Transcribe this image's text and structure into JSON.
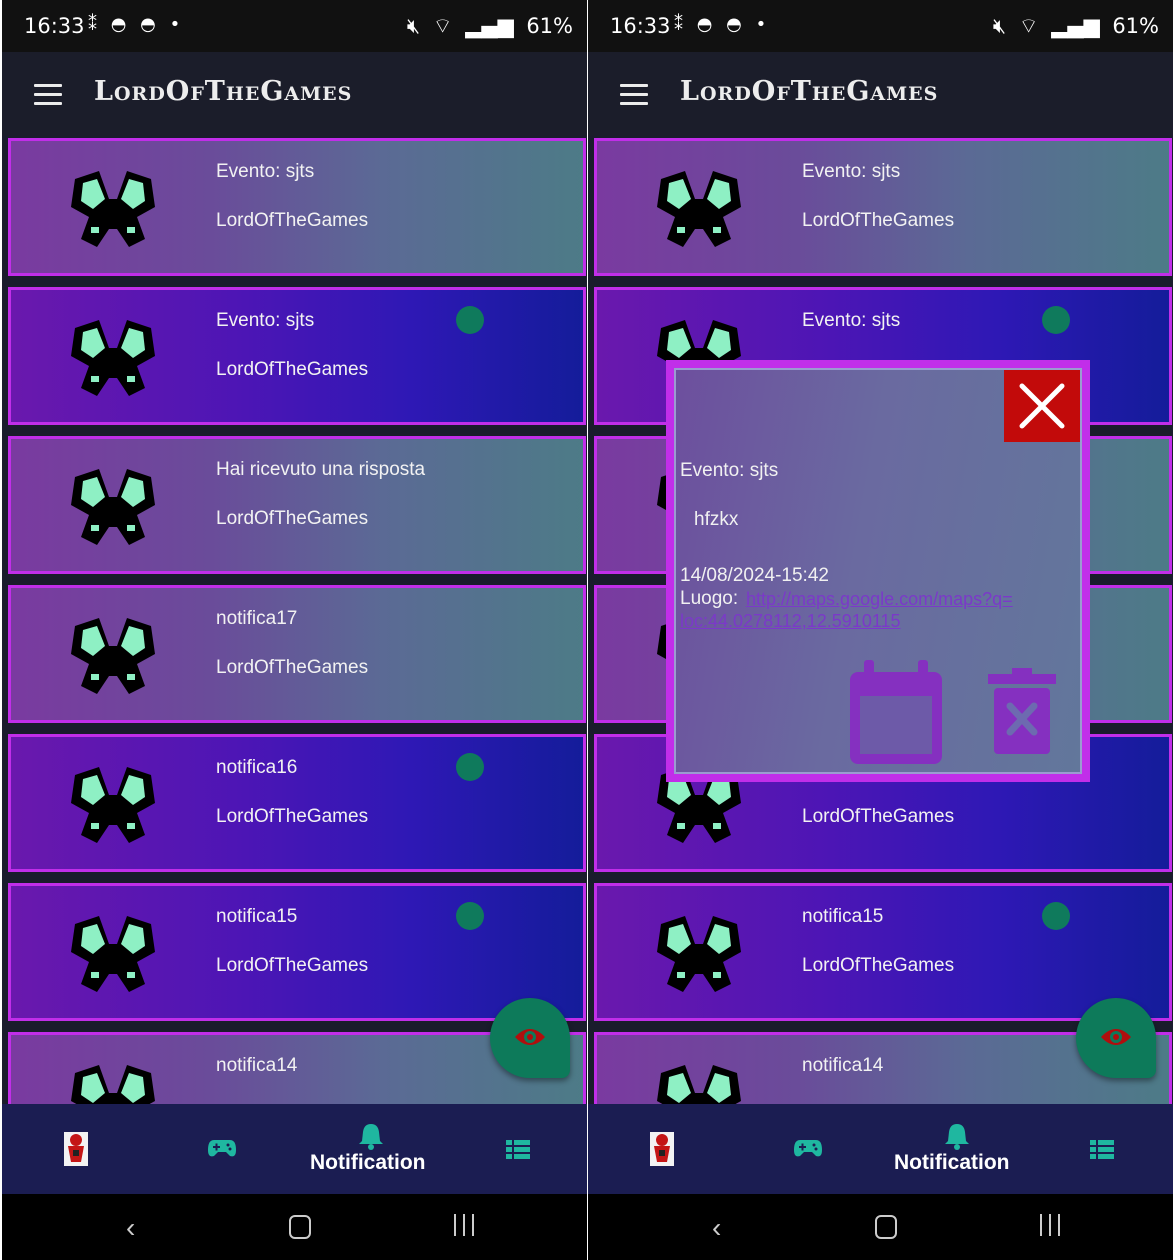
{
  "status_bar": {
    "time": "16:33",
    "battery": "61%"
  },
  "app": {
    "title": "LordOfTheGames"
  },
  "screens": [
    {
      "notifications": [
        {
          "title": "Evento: sjts",
          "subtitle": "LordOfTheGames",
          "unread": false
        },
        {
          "title": "Evento: sjts",
          "subtitle": "LordOfTheGames",
          "unread": true
        },
        {
          "title": "Hai ricevuto una risposta",
          "subtitle": "LordOfTheGames",
          "unread": false
        },
        {
          "title": "notifica17",
          "subtitle": "LordOfTheGames",
          "unread": false
        },
        {
          "title": "notifica16",
          "subtitle": "LordOfTheGames",
          "unread": true
        },
        {
          "title": "notifica15",
          "subtitle": "LordOfTheGames",
          "unread": true
        },
        {
          "title": "notifica14",
          "subtitle": "",
          "unread": false
        }
      ]
    },
    {
      "notifications": [
        {
          "title": "Evento: sjts",
          "subtitle": "LordOfTheGames",
          "unread": false
        },
        {
          "title": "Evento: sjts",
          "subtitle": "",
          "unread": true
        },
        {
          "title": "",
          "subtitle": "",
          "unread": false
        },
        {
          "title": "",
          "subtitle": "",
          "unread": false
        },
        {
          "title": "",
          "subtitle": "LordOfTheGames",
          "unread": true
        },
        {
          "title": "notifica15",
          "subtitle": "LordOfTheGames",
          "unread": true
        },
        {
          "title": "notifica14",
          "subtitle": "",
          "unread": false
        }
      ],
      "dialog": {
        "title": "Evento: sjts",
        "description": "hfzkx",
        "datetime": "14/08/2024-15:42",
        "location_label": "Luogo: ",
        "location_link_line1": "http://maps.google.com/maps?q=",
        "location_link_line2": "loc:44.0278112,12.5910115"
      }
    }
  ],
  "bottom_nav": {
    "items": [
      {
        "icon": "avatar-icon"
      },
      {
        "icon": "gamepad-icon"
      },
      {
        "icon": "bell-icon",
        "label": "Notification",
        "active": true
      },
      {
        "icon": "list-icon"
      }
    ]
  },
  "colors": {
    "accent_border": "#c12ee9",
    "unread_dot": "#0f7a5c",
    "fab": "#0d7a5a",
    "close_button": "#c20a0a",
    "nav_background": "#1b1d52"
  }
}
